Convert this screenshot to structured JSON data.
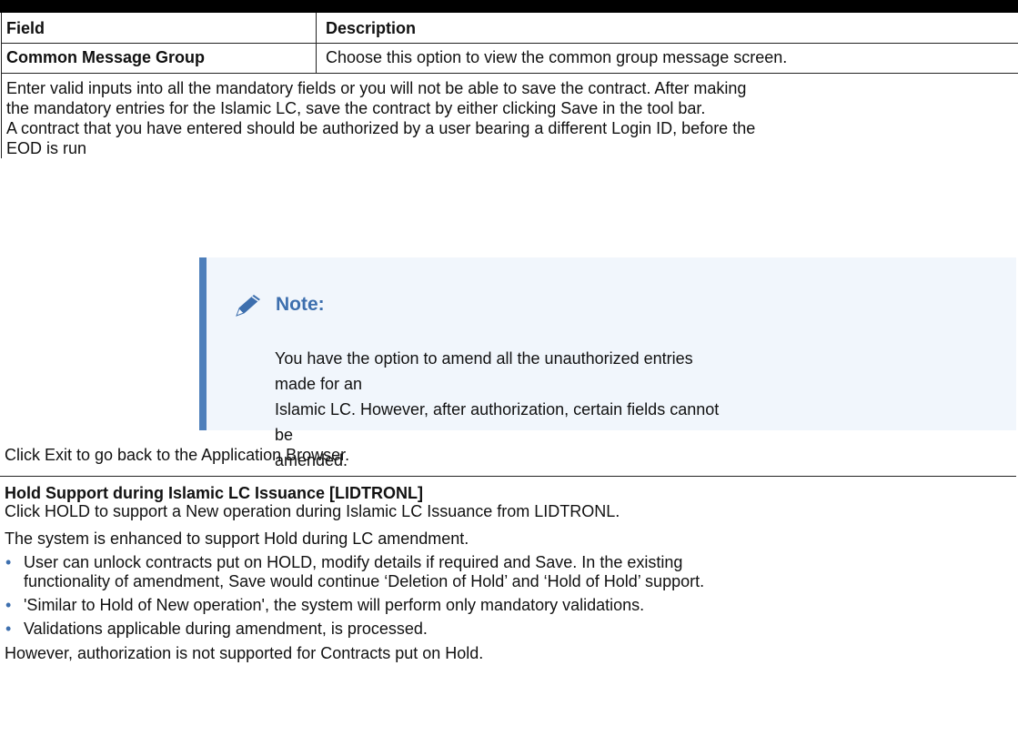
{
  "table": {
    "header": {
      "field": "Field",
      "description": "Description"
    },
    "rows": [
      {
        "field": "Common Message Group",
        "description": "Choose this option to view the common group message screen."
      }
    ]
  },
  "content": {
    "para1_line1": "Enter valid inputs into all the mandatory fields or you will not be able to save the contract. After making",
    "para1_line2": "the mandatory entries for the Islamic LC, save the contract by either clicking Save in the tool bar.",
    "para2_line1": "A contract that you have entered should be authorized by a user bearing a different Login ID, before the",
    "para2_line2": "EOD is run",
    "note": {
      "title": "Note:",
      "line1": "You have the option to amend all the unauthorized entries made for an",
      "line2": "Islamic LC. However, after authorization, certain fields cannot be",
      "line3": "amended.",
      "icon": "pencil-icon",
      "accent_color": "#4e7fbb",
      "background_color": "#f1f6fc"
    },
    "exit_text": "Click Exit to go back to the Application Browser."
  },
  "hold_section": {
    "title": "Hold Support during Islamic LC Issuance [LIDTRONL]",
    "intro": "Click HOLD to support a New operation during Islamic LC Issuance from LIDTRONL.",
    "enhanced": "The system is enhanced to support Hold during LC amendment.",
    "bullets": [
      {
        "line1": "User can unlock contracts put on HOLD, modify details if required and Save. In the existing",
        "line2": "functionality of amendment, Save would continue ‘Deletion of Hold’ and ‘Hold of Hold’ support."
      },
      {
        "line1": "'Similar to Hold of New operation', the system will perform only mandatory validations."
      },
      {
        "line1": "Validations applicable during amendment, is processed."
      }
    ],
    "closing": "However, authorization is not supported for Contracts put on Hold."
  }
}
